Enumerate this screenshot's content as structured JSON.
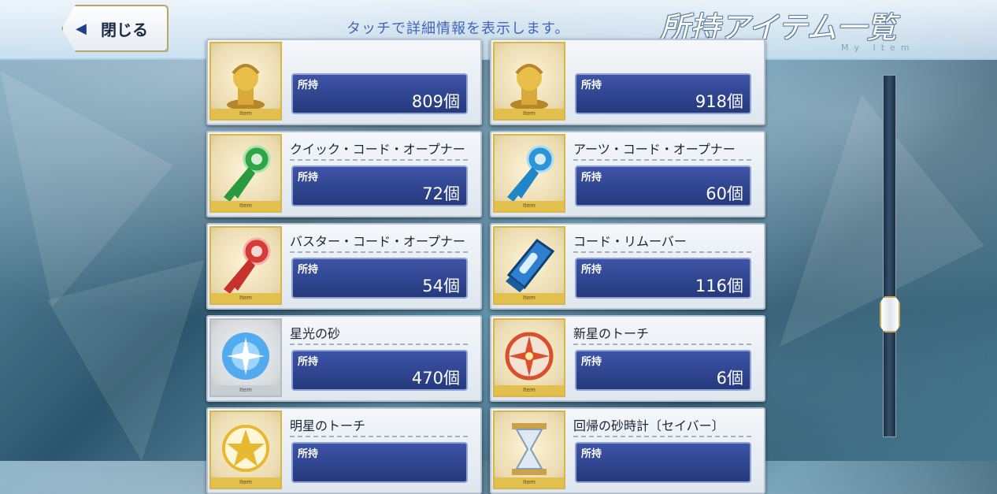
{
  "header": {
    "close_label": "閉じる",
    "hint": "タッチで詳細情報を表示します。",
    "title": "所持アイテム一覧",
    "subtitle": "My Item"
  },
  "item_card": {
    "held_label": "所持",
    "thumb_tag": "Item"
  },
  "items": [
    {
      "name": "",
      "quantity": "809個",
      "icon": "gold-statue-icon",
      "accent": "#d7a83a"
    },
    {
      "name": "",
      "quantity": "918個",
      "icon": "gold-statue-icon",
      "accent": "#d7a83a"
    },
    {
      "name": "クイック・コード・オープナー",
      "quantity": "72個",
      "icon": "green-key-icon",
      "accent": "#2fa544"
    },
    {
      "name": "アーツ・コード・オープナー",
      "quantity": "60個",
      "icon": "blue-key-icon",
      "accent": "#2b95d6"
    },
    {
      "name": "バスター・コード・オープナー",
      "quantity": "54個",
      "icon": "red-key-icon",
      "accent": "#d63b34"
    },
    {
      "name": "コード・リムーバー",
      "quantity": "116個",
      "icon": "code-remover-icon",
      "accent": "#2e7fcf"
    },
    {
      "name": "星光の砂",
      "quantity": "470個",
      "icon": "stardust-icon",
      "accent": "#3aa0f0"
    },
    {
      "name": "新星のトーチ",
      "quantity": "6個",
      "icon": "nova-torch-icon",
      "accent": "#d8502e"
    },
    {
      "name": "明星のトーチ",
      "quantity": "",
      "icon": "morning-star-torch-icon",
      "accent": "#e8b830"
    },
    {
      "name": "回帰の砂時計〔セイバー〕",
      "quantity": "",
      "icon": "hourglass-icon",
      "accent": "#c9a24a"
    }
  ]
}
